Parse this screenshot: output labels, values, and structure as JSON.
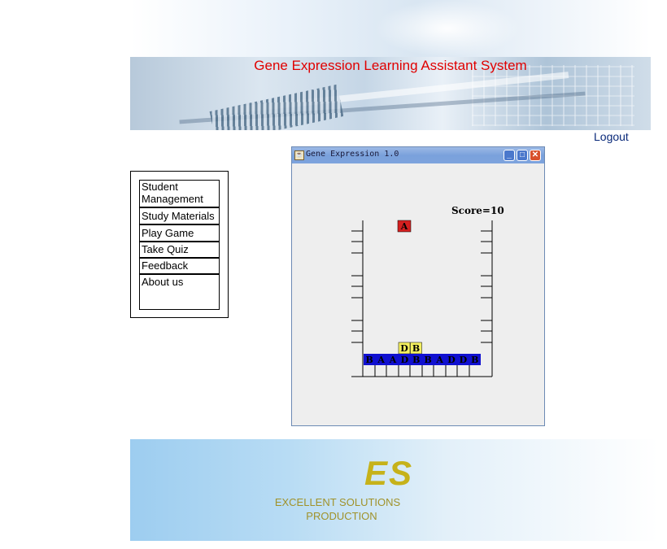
{
  "header": {
    "title": "Gene Expression Learning Assistant System",
    "logout_label": "Logout"
  },
  "nav": {
    "items": [
      {
        "label": "Student Management"
      },
      {
        "label": "Study Materials"
      },
      {
        "label": "Play Game"
      },
      {
        "label": "Take Quiz"
      },
      {
        "label": "Feedback"
      },
      {
        "label": "About us"
      }
    ]
  },
  "game_window": {
    "title": "Gene Expression 1.0",
    "score_text": "Score=10",
    "falling_piece": {
      "letter": "A",
      "color": "#d42020"
    },
    "stacked_pieces": [
      {
        "letter": "D",
        "color": "#f4f060"
      },
      {
        "letter": "B",
        "color": "#f4f060"
      }
    ],
    "gene_row": [
      "B",
      "A",
      "A",
      "D",
      "B",
      "B",
      "A",
      "D",
      "D",
      "B"
    ],
    "gene_row_color": "#1010d0",
    "icons": [
      "app-icon",
      "minimize-icon",
      "maximize-icon",
      "close-icon"
    ]
  },
  "footer": {
    "logo_text": "ES",
    "line1": "EXCELLENT SOLUTIONS",
    "line2": "PRODUCTION"
  }
}
